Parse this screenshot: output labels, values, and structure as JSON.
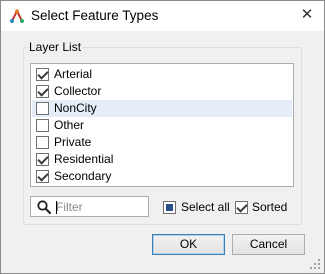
{
  "window": {
    "title": "Select Feature Types",
    "icons": {
      "app": "fme-workbench-icon",
      "close": "close-icon"
    }
  },
  "group": {
    "label": "Layer List"
  },
  "layers": [
    {
      "label": "Arterial",
      "checked": true
    },
    {
      "label": "Collector",
      "checked": true
    },
    {
      "label": "NonCity",
      "checked": false
    },
    {
      "label": "Other",
      "checked": false
    },
    {
      "label": "Private",
      "checked": false
    },
    {
      "label": "Residential",
      "checked": true
    },
    {
      "label": "Secondary",
      "checked": true
    }
  ],
  "filter": {
    "placeholder": "Filter",
    "value": ""
  },
  "select_all": {
    "label": "Select all",
    "state": "indeterminate"
  },
  "sorted": {
    "label": "Sorted",
    "checked": true
  },
  "buttons": {
    "ok": "OK",
    "cancel": "Cancel"
  },
  "colors": {
    "hover_row": "#e5eef8",
    "default_button_border": "#3c7fb1"
  }
}
